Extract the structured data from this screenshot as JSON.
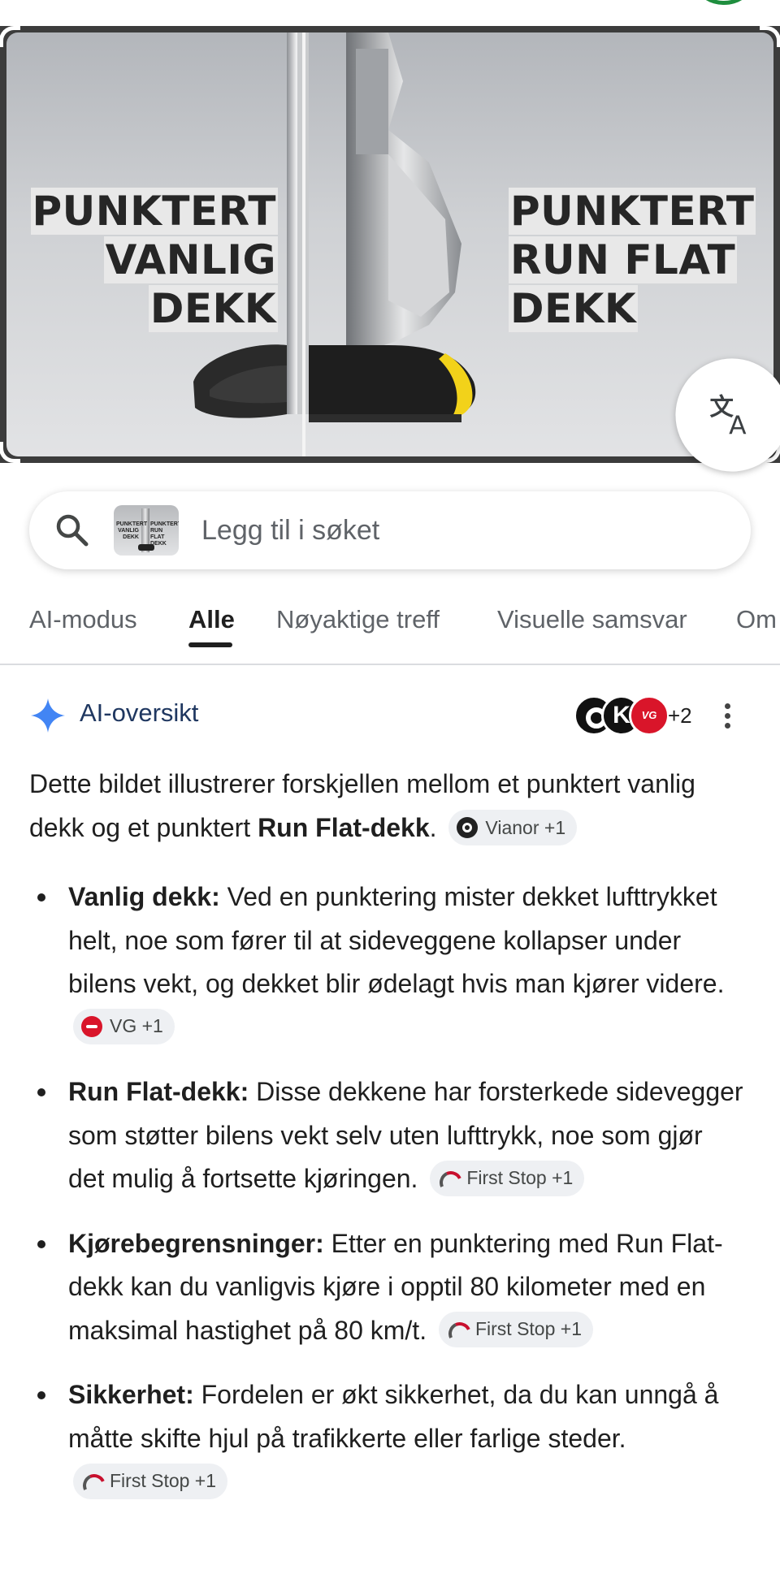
{
  "hero": {
    "left_text": [
      "PUNKTERT",
      "VANLIG",
      "DEKK"
    ],
    "right_text": [
      "PUNKTERT",
      "RUN FLAT",
      "DEKK"
    ],
    "translate_icon": "translate-icon"
  },
  "search": {
    "placeholder": "Legg til i søket",
    "icon": "search-icon",
    "thumb_left": "PUNKTERT VANLIG DEKK",
    "thumb_right": "PUNKTERT RUN FLAT DEKK"
  },
  "tabs": [
    "AI-modus",
    "Alle",
    "Nøyaktige treff",
    "Visuelle samsvar",
    "Om"
  ],
  "active_tab": "Alle",
  "ai_overview": {
    "title": "AI-oversikt",
    "sources_more": "+2",
    "logo_b": "K",
    "logo_c": "VG",
    "intro_prefix": "Dette bildet illustrerer forskjellen mellom et punktert vanlig dekk og et punktert ",
    "intro_bold": "Run Flat-dekk",
    "intro_suffix": ".",
    "intro_chip": "Vianor +1",
    "bullets": [
      {
        "bold": "Vanlig dekk:",
        "text": " Ved en punktering mister dekket lufttrykket helt, noe som fører til at sideveggene kollapser under bilens vekt, og dekket blir ødelagt hvis man kjører videre.",
        "chip": "VG +1",
        "chip_icon": "vg"
      },
      {
        "bold": "Run Flat-dekk:",
        "text": " Disse dekkene har forsterkede sidevegger som støtter bilens vekt selv uten lufttrykk, noe som gjør det mulig å fortsette kjøringen.",
        "chip": "First Stop +1",
        "chip_icon": "fs"
      },
      {
        "bold": "Kjørebegrensninger:",
        "text": " Etter en punktering med Run Flat-dekk kan du vanligvis kjøre i opptil 80 kilometer med en maksimal hastighet på 80 km/t.",
        "chip": "First Stop +1",
        "chip_icon": "fs"
      },
      {
        "bold": "Sikkerhet:",
        "text": " Fordelen er økt sikkerhet, da du kan unngå å måtte skifte hjul på trafikkerte eller farlige steder.",
        "chip": "First Stop +1",
        "chip_icon": "fs"
      }
    ]
  },
  "colors": {
    "accent": "#1f3760",
    "spark_blue": "#4285f4",
    "vg_red": "#d9152a",
    "status_green": "#1e8e3e"
  }
}
